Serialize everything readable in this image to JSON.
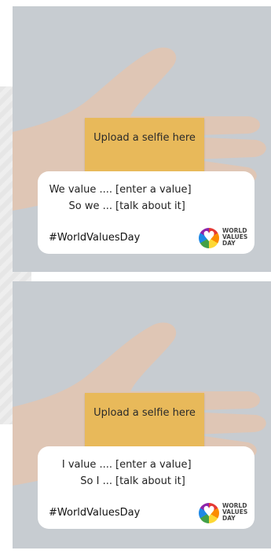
{
  "cards": [
    {
      "note": "Upload a selfie here",
      "line1_left": "We value ....",
      "line1_right": "[enter a value]",
      "line2_left": "So we ...",
      "line2_right": "[talk about it]",
      "hashtag": "#WorldValuesDay",
      "logo": {
        "w": "WORLD",
        "v": "VALUES",
        "d": "DAY"
      }
    },
    {
      "note": "Upload a selfie here",
      "line1_left": "I value ....",
      "line1_right": "[enter a value]",
      "line2_left": "So I ...",
      "line2_right": "[talk about it]",
      "hashtag": "#WorldValuesDay",
      "logo": {
        "w": "WORLD",
        "v": "VALUES",
        "d": "DAY"
      }
    }
  ],
  "colors": {
    "card_bg": "#c7ccd1",
    "note": "#e8b95a",
    "panel": "#ffffff"
  }
}
